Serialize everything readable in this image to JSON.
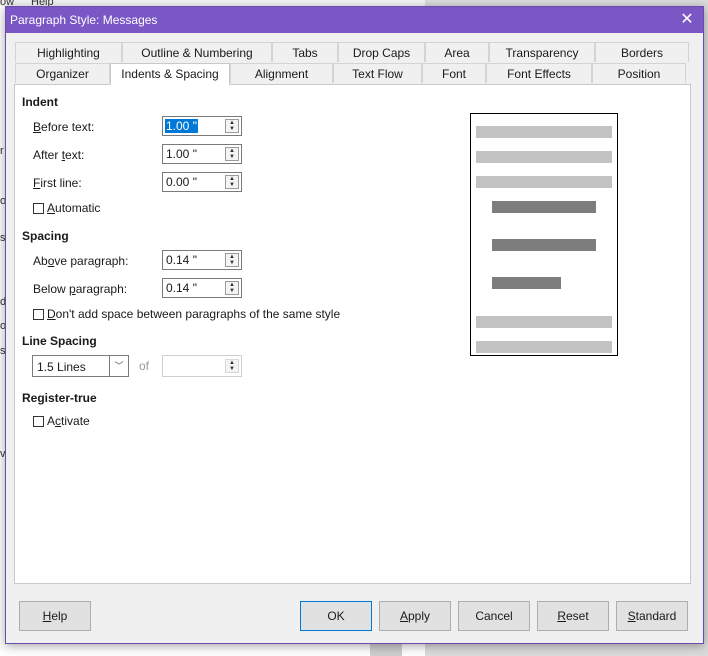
{
  "background": {
    "menu_fragments": [
      "ow",
      "Help"
    ],
    "edge_chars": [
      "r",
      "o",
      "s",
      "d",
      "o",
      "s",
      "v"
    ]
  },
  "dialog": {
    "title": "Paragraph Style: Messages",
    "close_glyph": "✕"
  },
  "tabs": {
    "row1": [
      "Highlighting",
      "Outline & Numbering",
      "Tabs",
      "Drop Caps",
      "Area",
      "Transparency",
      "Borders"
    ],
    "row2": [
      "Organizer",
      "Indents & Spacing",
      "Alignment",
      "Text Flow",
      "Font",
      "Font Effects",
      "Position"
    ],
    "active": "Indents & Spacing"
  },
  "indent": {
    "heading": "Indent",
    "before_text": {
      "label_u": "B",
      "label_rest": "efore text:",
      "value": "1.00 \""
    },
    "after_text": {
      "label_pre": "After ",
      "label_u": "t",
      "label_rest": "ext:",
      "value": "1.00 \""
    },
    "first_line": {
      "label_u": "F",
      "label_rest": "irst line:",
      "value": "0.00 \""
    },
    "automatic": {
      "label_u": "A",
      "label_rest": "utomatic",
      "checked": false
    }
  },
  "spacing": {
    "heading": "Spacing",
    "above": {
      "label_pre": "Ab",
      "label_u": "o",
      "label_rest": "ve paragraph:",
      "value": "0.14 \""
    },
    "below": {
      "label_pre": "Below ",
      "label_u": "p",
      "label_rest": "aragraph:",
      "value": "0.14 \""
    },
    "dont_add": {
      "label_u": "D",
      "label_rest": "on't add space between paragraphs of the same style",
      "checked": false
    }
  },
  "line_spacing": {
    "heading": "Line Spacing",
    "selected": "1.5 Lines",
    "of_label": "of",
    "of_value": ""
  },
  "register_true": {
    "heading": "Register-true",
    "activate": {
      "label_pre": "A",
      "label_u": "c",
      "label_rest": "tivate",
      "checked": false
    }
  },
  "preview": {
    "colors": {
      "light": "#c3c3c3",
      "dark": "#7d7d7d"
    }
  },
  "buttons": {
    "help": {
      "u": "H",
      "rest": "elp"
    },
    "ok": "OK",
    "apply": {
      "u": "A",
      "rest": "pply"
    },
    "cancel": "Cancel",
    "reset": {
      "u": "R",
      "rest": "eset"
    },
    "standard": {
      "u": "S",
      "rest": "tandard"
    }
  },
  "colors": {
    "accent": "#7a57c4",
    "selection": "#0078d7"
  }
}
